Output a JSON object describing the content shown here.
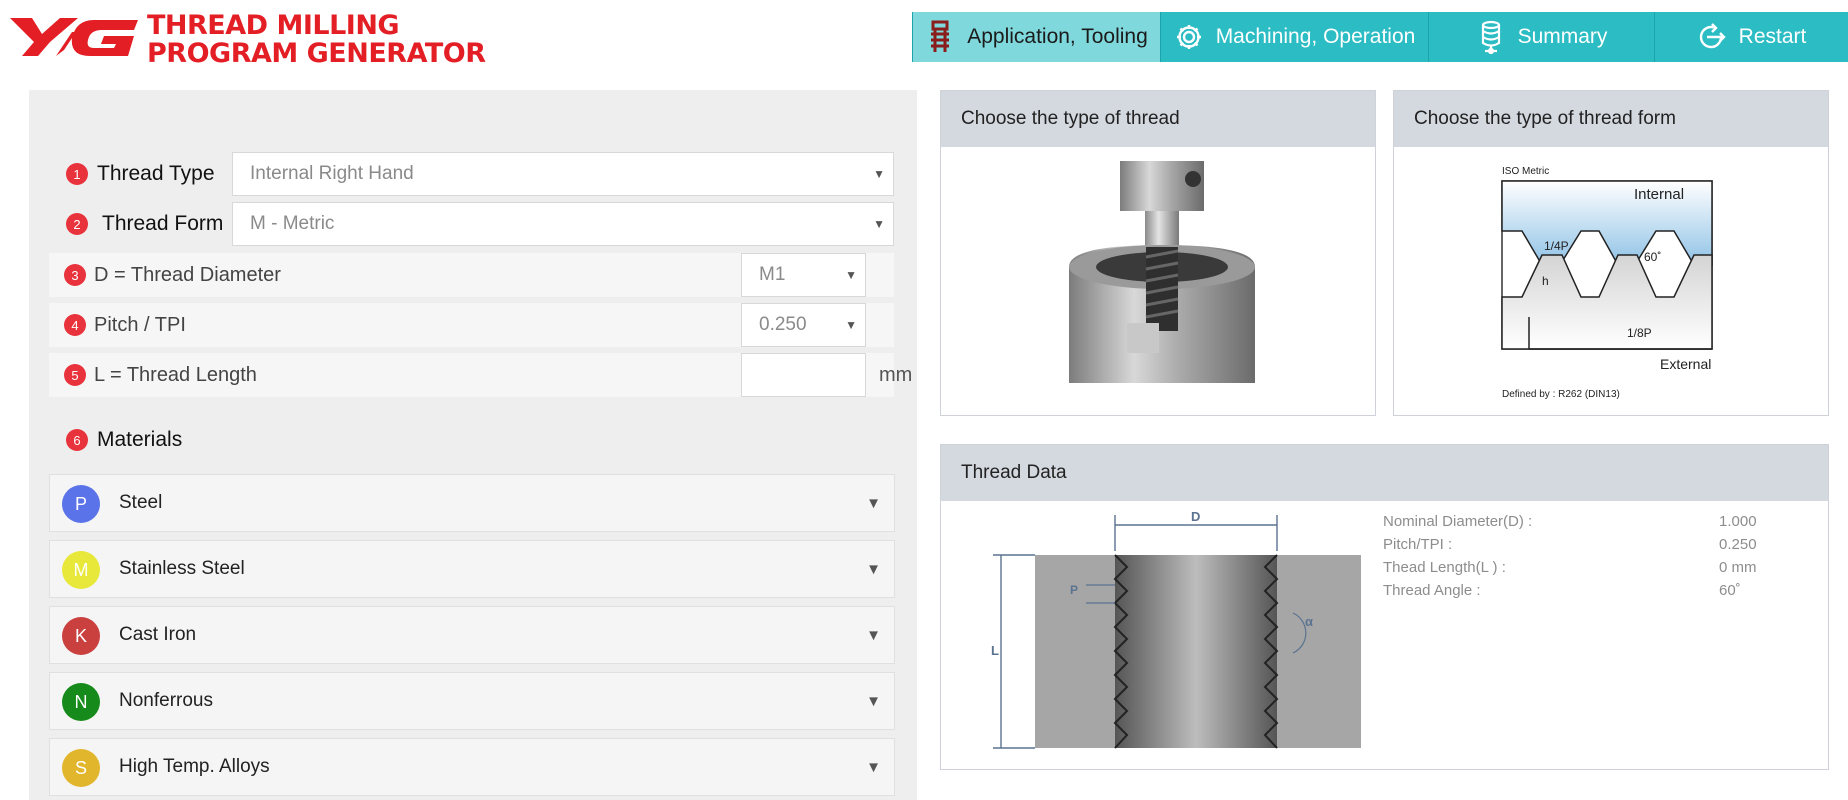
{
  "header": {
    "title_line1": "THREAD MILLING",
    "title_line2": "PROGRAM GENERATOR",
    "brand_color": "#e31e25",
    "nav": [
      {
        "label": "Application, Tooling",
        "icon": "tool-holder-icon",
        "active": true
      },
      {
        "label": "Machining, Operation",
        "icon": "gear-icon",
        "active": false
      },
      {
        "label": "Summary",
        "icon": "database-icon",
        "active": false
      },
      {
        "label": "Restart",
        "icon": "restart-icon",
        "active": false
      }
    ]
  },
  "form": {
    "thread_type": {
      "num": "1",
      "label": "Thread Type",
      "value": "Internal Right Hand"
    },
    "thread_form": {
      "num": "2",
      "label": "Thread Form",
      "value": "M - Metric"
    },
    "diameter": {
      "num": "3",
      "label": "D = Thread Diameter",
      "value": "M1"
    },
    "pitch": {
      "num": "4",
      "label": "Pitch / TPI",
      "value": "0.250"
    },
    "length": {
      "num": "5",
      "label": "L = Thread Length",
      "value": "",
      "unit": "mm"
    }
  },
  "materials": {
    "num": "6",
    "label": "Materials",
    "items": [
      {
        "letter": "P",
        "name": "Steel",
        "color": "#5b73e8"
      },
      {
        "letter": "M",
        "name": "Stainless Steel",
        "color": "#e8e83a"
      },
      {
        "letter": "K",
        "name": "Cast Iron",
        "color": "#c9403f"
      },
      {
        "letter": "N",
        "name": "Nonferrous",
        "color": "#168a1a"
      },
      {
        "letter": "S",
        "name": "High Temp. Alloys",
        "color": "#e2b62c"
      }
    ]
  },
  "cards": {
    "thread_type_title": "Choose the type of thread",
    "thread_form_title": "Choose the type of thread form",
    "thread_form_diagram": {
      "iso": "ISO Metric",
      "internal": "Internal",
      "external": "External",
      "quarter_p": "1/4P",
      "eighth_p": "1/8P",
      "h": "h",
      "angle": "60˚",
      "defined": "Defined by : R262 (DIN13)"
    },
    "thread_data_title": "Thread Data",
    "thread_data_diagram": {
      "d": "D",
      "l": "L",
      "p": "P",
      "a": "α"
    },
    "thread_data": [
      {
        "key": "Nominal Diameter(D) :",
        "value": "1.000"
      },
      {
        "key": "Pitch/TPI :",
        "value": "0.250"
      },
      {
        "key": "Thead Length(L  ) :",
        "value": "0 mm"
      },
      {
        "key": "Thread Angle :",
        "value": "60˚"
      }
    ]
  }
}
